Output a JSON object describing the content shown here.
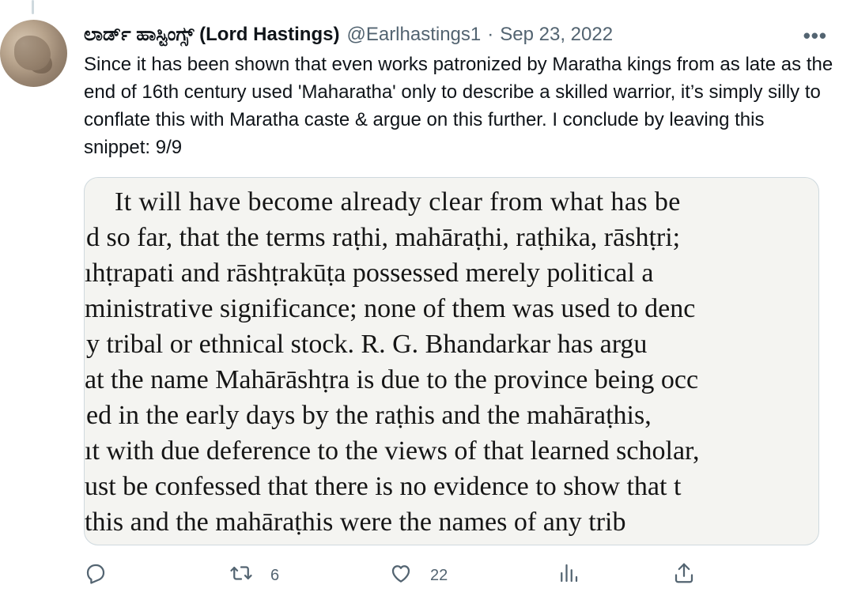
{
  "tweet": {
    "display_name": "ಲಾರ್ಡ್ ಹಾಸ್ಟಿಂಗ್ಸ್ (Lord Hastings)",
    "handle": "@Earlhastings1",
    "separator": "·",
    "date": "Sep 23, 2022",
    "more_label": "•••",
    "text": "Since it has been shown that even works patronized by Maratha kings from as late as the end of 16th century used 'Maharatha' only to describe a skilled warrior, it’s simply silly to conflate this with Maratha caste & argue on this further. I conclude by leaving this snippet: 9/9"
  },
  "media": {
    "lines": [
      "It will have become already clear  from  what  has  be",
      "d so far, that the terms raṭhi, mahāraṭhi, raṭhika, rāshṭri;",
      "ıhṭrapati and rāshṭrakūṭa  possessed  merely  political  a",
      "ministrative significance; none of them was used  to denc",
      "y tribal or ethnical stock.   R. G.  Bhandarkar  has  argu",
      "at the name Mahārāshṭra is due to the province being occ",
      "ed in the early days by the  raṭhis  and  the  mahāraṭhis,",
      "ıt with due deference to the views of that learned scholar,",
      "ust be confessed that there is no evidence to show  that  t",
      "this  and  the  mahāraṭhis  were  the  names  of  any  trib"
    ]
  },
  "actions": {
    "reply_count": "",
    "retweet_count": "6",
    "like_count": "22",
    "views_count": "",
    "icons": [
      "reply-icon",
      "retweet-icon",
      "like-icon",
      "views-icon",
      "share-icon"
    ]
  },
  "colors": {
    "text_primary": "#0f1419",
    "text_secondary": "#536471",
    "border": "#cfd9de"
  }
}
